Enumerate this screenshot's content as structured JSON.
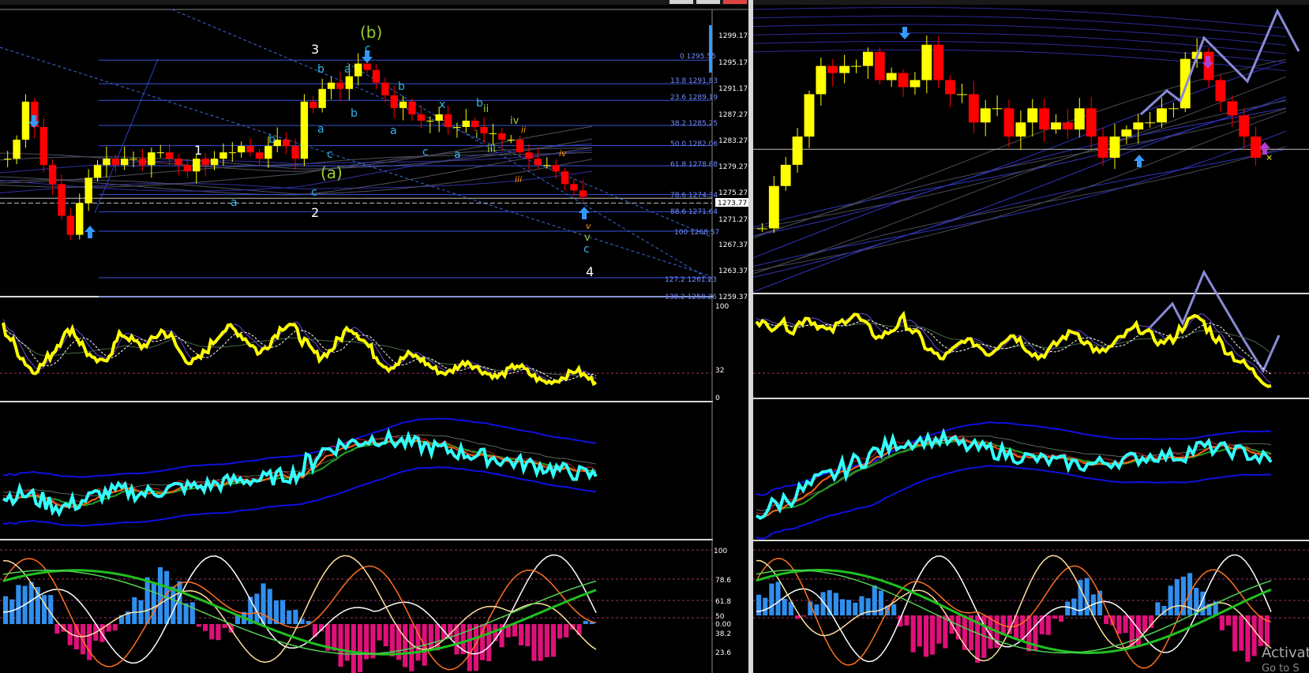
{
  "colors": {
    "background": "#000000",
    "frame": "#d8d8d8",
    "bull_candle": "#ffff00",
    "bear_candle": "#ff0000",
    "fib_line": "#3a54d8",
    "fib_text": "#6f8cff",
    "arrow": "#3399ff",
    "yellow_osc": "#ffff00",
    "cyan_line": "#33ffff",
    "macd_up": "#2f8fef",
    "macd_down": "#e0107a",
    "projection": "#8a8ad8"
  },
  "chart_data": [
    {
      "type": "candlestick",
      "panel": "left-main",
      "price_axis_labels": [
        "1299.17",
        "1295.17",
        "1291.17",
        "1287.27",
        "1283.27",
        "1279.27",
        "1275.27",
        "1271.27",
        "1267.37",
        "1263.37",
        "1259.37"
      ],
      "current_price": "1273.77",
      "fib_levels": [
        {
          "ratio": "0",
          "price": "1295.55"
        },
        {
          "ratio": "13.8",
          "price": "1291.83"
        },
        {
          "ratio": "23.6",
          "price": "1289.19"
        },
        {
          "ratio": "38.2",
          "price": "1285.25"
        },
        {
          "ratio": "50.0",
          "price": "1282.06"
        },
        {
          "ratio": "61.8",
          "price": "1278.88"
        },
        {
          "ratio": "78.6",
          "price": "1274.34"
        },
        {
          "ratio": "88.6",
          "price": "1271.64"
        },
        {
          "ratio": "100",
          "price": "1268.57"
        },
        {
          "ratio": "127.2",
          "price": "1261.23"
        },
        {
          "ratio": "138.2",
          "price": "1258.26"
        }
      ],
      "wave_labels": [
        "1",
        "2",
        "3",
        "4",
        "(a)",
        "(b)",
        "a",
        "b",
        "c",
        "x",
        "i",
        "ii",
        "iii",
        "iv",
        "v"
      ],
      "close": [
        1280,
        1283,
        1289,
        1285,
        1279,
        1276,
        1271,
        1268,
        1273,
        1277,
        1279,
        1280,
        1279,
        1280,
        1280,
        1279,
        1281,
        1281,
        1280,
        1279,
        1278,
        1280,
        1279,
        1280,
        1281,
        1281,
        1282,
        1281,
        1280,
        1282,
        1283,
        1282,
        1280,
        1289,
        1288,
        1291,
        1292,
        1291,
        1293,
        1295,
        1294,
        1292,
        1290,
        1288,
        1289,
        1287,
        1286,
        1286,
        1287,
        1285,
        1285,
        1286,
        1285,
        1284,
        1284,
        1283,
        1283,
        1281,
        1280,
        1279,
        1279,
        1278,
        1276,
        1275,
        1274
      ]
    },
    {
      "type": "candlestick",
      "panel": "right-main",
      "close": [
        1271,
        1277,
        1280,
        1284,
        1290,
        1294,
        1293,
        1294,
        1294,
        1296,
        1292,
        1293,
        1291,
        1292,
        1297,
        1292,
        1290,
        1290,
        1286,
        1288,
        1288,
        1284,
        1286,
        1288,
        1285,
        1286,
        1285,
        1288,
        1284,
        1281,
        1284,
        1285,
        1286,
        1286,
        1288,
        1288,
        1295,
        1296,
        1292,
        1289,
        1287,
        1284,
        1281
      ],
      "projection_arrows": 3
    },
    {
      "type": "line",
      "panel": "left-oscillator",
      "ylim": [
        0,
        100
      ],
      "tick_labels": [
        "100",
        "32",
        "0"
      ],
      "series": [
        {
          "values": [
            80,
            62,
            45,
            30,
            38,
            52,
            70,
            78,
            60,
            44,
            40,
            55,
            72,
            66,
            58,
            64,
            76,
            68,
            50,
            40,
            46,
            60,
            74,
            80,
            72,
            62,
            50,
            64,
            78,
            84,
            70,
            56,
            46,
            52,
            66,
            80,
            72,
            58,
            44,
            34,
            40,
            50,
            46,
            38,
            30,
            28,
            36,
            42,
            34,
            28,
            24,
            30,
            38,
            30,
            22,
            18,
            20,
            26,
            32,
            24,
            18
          ]
        }
      ]
    },
    {
      "type": "line",
      "panel": "right-oscillator",
      "ylim": [
        0,
        100
      ],
      "series": [
        {
          "values": [
            84,
            72,
            80,
            70,
            86,
            76,
            68,
            80,
            88,
            74,
            62,
            70,
            82,
            66,
            50,
            38,
            46,
            60,
            54,
            44,
            58,
            66,
            52,
            40,
            48,
            62,
            70,
            56,
            44,
            52,
            64,
            74,
            66,
            56,
            62,
            78,
            86,
            70,
            54,
            40,
            30,
            18,
            8
          ]
        }
      ]
    },
    {
      "type": "line",
      "panel": "left-moving-averages",
      "series": [
        {
          "name": "",
          "values": [
            1271,
            1272,
            1270,
            1268,
            1270,
            1272,
            1273,
            1272,
            1273,
            1274,
            1274,
            1275,
            1276,
            1276,
            1277,
            1278,
            1284,
            1286,
            1287,
            1288,
            1287,
            1286,
            1285,
            1284,
            1283,
            1282,
            1281,
            1280,
            1279,
            1278,
            1277
          ]
        }
      ]
    },
    {
      "type": "line",
      "panel": "right-moving-averages",
      "series": [
        {
          "name": "",
          "values": [
            1262,
            1266,
            1270,
            1274,
            1278,
            1282,
            1285,
            1286,
            1286,
            1284,
            1283,
            1281,
            1280,
            1279,
            1278,
            1279,
            1280,
            1281,
            1281,
            1284,
            1283,
            1282,
            1279
          ]
        }
      ]
    },
    {
      "type": "bar",
      "panel": "left-histogram-stochastic",
      "tick_labels": [
        "100",
        "78.6",
        "61.8",
        "50",
        "0.00",
        "38.2",
        "23.6"
      ],
      "values": [
        40,
        55,
        60,
        40,
        -10,
        -35,
        -50,
        -30,
        -10,
        15,
        40,
        65,
        85,
        60,
        30,
        -5,
        -20,
        -10,
        20,
        45,
        55,
        40,
        25,
        10,
        -15,
        -40,
        -60,
        -75,
        -55,
        -30,
        -50,
        -70,
        -60,
        -40,
        -25,
        -45,
        -65,
        -50,
        -30,
        -15,
        -35,
        -55,
        -45,
        -25,
        -10,
        5
      ]
    },
    {
      "type": "bar",
      "panel": "right-histogram-stochastic",
      "values": [
        30,
        45,
        25,
        -5,
        15,
        35,
        30,
        20,
        25,
        40,
        15,
        -20,
        -50,
        -60,
        -45,
        -30,
        -55,
        -65,
        -45,
        -25,
        -40,
        -55,
        -30,
        -10,
        20,
        50,
        35,
        -10,
        -30,
        -45,
        -20,
        15,
        50,
        60,
        40,
        20,
        -20,
        -50,
        -65,
        -45
      ]
    }
  ],
  "watermark": {
    "line1": "Activat",
    "line2": "Go to S"
  }
}
